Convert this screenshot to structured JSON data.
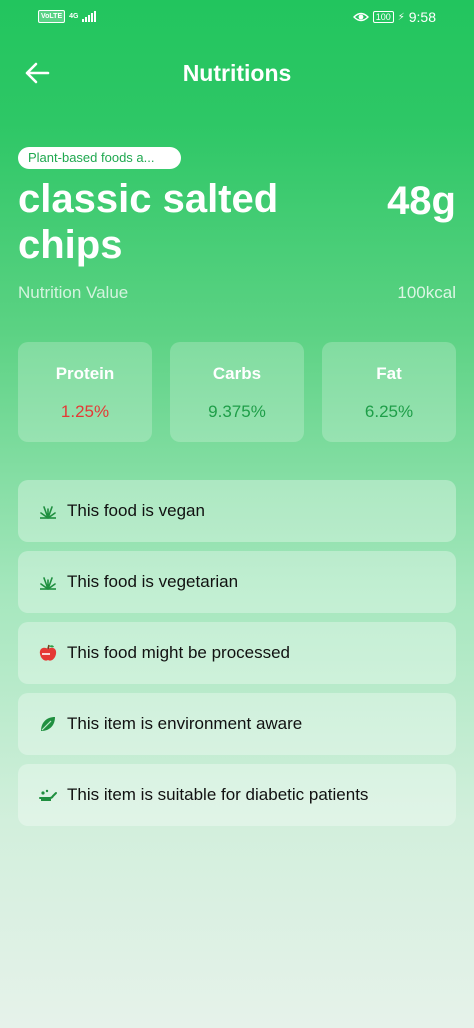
{
  "status_bar": {
    "volte": "VoLTE",
    "network": "4G",
    "battery": "100",
    "time": "9:58"
  },
  "header": {
    "title": "Nutritions"
  },
  "food": {
    "category": "Plant-based foods a...",
    "name": "classic salted chips",
    "serving_size": "48g",
    "nutrition_label": "Nutrition Value",
    "energy": "100kcal"
  },
  "macros": [
    {
      "label": "Protein",
      "value": "1.25%",
      "color": "#e53935"
    },
    {
      "label": "Carbs",
      "value": "9.375%",
      "color": "#1e9e48"
    },
    {
      "label": "Fat",
      "value": "6.25%",
      "color": "#1e9e48"
    }
  ],
  "facts": [
    {
      "text": "This food is vegan",
      "icon": "sprout-icon"
    },
    {
      "text": "This food is vegetarian",
      "icon": "sprout-icon"
    },
    {
      "text": "This food might be processed",
      "icon": "apple-icon"
    },
    {
      "text": "This item is environment aware",
      "icon": "leaf-icon"
    },
    {
      "text": "This item is suitable for diabetic patients",
      "icon": "sugar-icon"
    }
  ],
  "colors": {
    "brand_green": "#22c55e",
    "warning_red": "#e53935",
    "good_green": "#1e9e48"
  }
}
